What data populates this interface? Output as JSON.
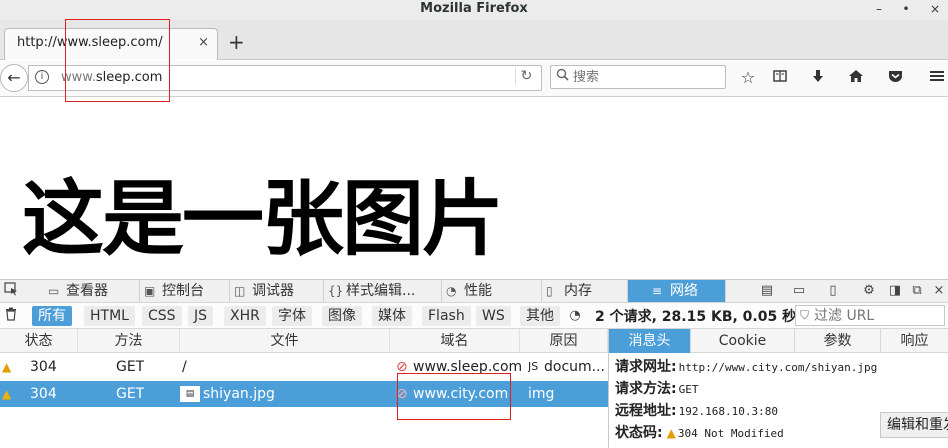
{
  "window": {
    "title": "Mozilla Firefox",
    "minimize_glyph": "–",
    "maximize_glyph": "•",
    "close_glyph": "×"
  },
  "tab": {
    "label": "http://www.sleep.com/",
    "close_glyph": "×",
    "new_tab_glyph": "+"
  },
  "navbar": {
    "url_prefix": "www.",
    "url_host": "sleep.com",
    "search_placeholder": "搜索",
    "back_glyph": "←",
    "reload_glyph": "↻",
    "icons": [
      "bookmark-star-icon",
      "reading-list-icon",
      "download-icon",
      "home-icon",
      "pocket-icon",
      "menu-icon"
    ]
  },
  "page": {
    "heading": "这是一张图片"
  },
  "devtools": {
    "tabs": [
      {
        "label": "查看器",
        "icon": "inspector-icon"
      },
      {
        "label": "控制台",
        "icon": "console-icon"
      },
      {
        "label": "调试器",
        "icon": "debugger-icon"
      },
      {
        "label": "样式编辑...",
        "icon": "style-editor-icon"
      },
      {
        "label": "性能",
        "icon": "performance-icon"
      },
      {
        "label": "内存",
        "icon": "memory-icon"
      },
      {
        "label": "网络",
        "icon": "network-icon",
        "selected": true
      }
    ],
    "filters": [
      "所有",
      "HTML",
      "CSS",
      "JS",
      "XHR",
      "字体",
      "图像",
      "媒体",
      "Flash",
      "WS",
      "其他"
    ],
    "selected_filter": "所有",
    "summary": "2 个请求, 28.15 KB, 0.05 秒",
    "filter_url_placeholder": "过滤 URL",
    "columns": [
      "状态",
      "方法",
      "文件",
      "域名",
      "原因"
    ],
    "requests": [
      {
        "status": "304",
        "method": "GET",
        "file": "/",
        "domain": "www.sleep.com",
        "cause": "docum..."
      },
      {
        "status": "304",
        "method": "GET",
        "file": "shiyan.jpg",
        "domain": "www.city.com",
        "cause": "img",
        "selected": true
      }
    ],
    "detail_tabs": [
      "消息头",
      "Cookie",
      "参数",
      "响应"
    ],
    "selected_detail_tab": "消息头",
    "details": {
      "request_url_label": "请求网址:",
      "request_url": "http://www.city.com/shiyan.jpg",
      "request_method_label": "请求方法:",
      "request_method": "GET",
      "remote_address_label": "远程地址:",
      "remote_address": "192.168.10.3:80",
      "status_code_label": "状态码:",
      "status_code": "304 Not Modified"
    },
    "edit_button": "编辑和重发"
  },
  "colors": {
    "accent": "#4c9ed9",
    "annotation": "#e02020",
    "warning": "#e0a000"
  }
}
